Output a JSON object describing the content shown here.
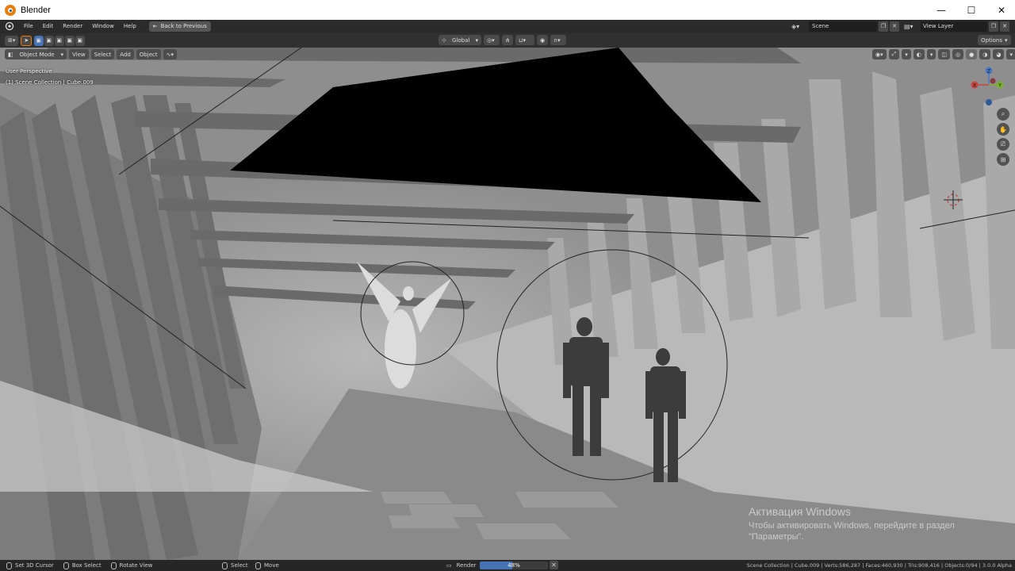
{
  "window": {
    "title": "Blender",
    "minimize": "—",
    "maximize": "☐",
    "close": "✕"
  },
  "topbar": {
    "menus": [
      "File",
      "Edit",
      "Render",
      "Window",
      "Help"
    ],
    "back_label": "Back to Previous",
    "scene_label": "Scene",
    "view_layer_label": "View Layer"
  },
  "tool_header": {
    "orientation": "Global",
    "options_label": "Options"
  },
  "viewport_header": {
    "mode": "Object Mode",
    "menus": [
      "View",
      "Select",
      "Add",
      "Object"
    ]
  },
  "viewport_overlay": {
    "perspective": "User Perspective",
    "collection": "(1) Scene Collection | Cube.009"
  },
  "gizmo": {
    "x": "X",
    "y": "Y",
    "z": "Z"
  },
  "activation": {
    "title": "Активация Windows",
    "line1": "Чтобы активировать Windows, перейдите в раздел",
    "line2": "\"Параметры\"."
  },
  "statusbar": {
    "items": [
      "Set 3D Cursor",
      "Box Select",
      "Rotate View",
      "Select",
      "Move"
    ],
    "render_label": "Render",
    "progress_text": "48%",
    "progress": 0.48,
    "stats": "Scene Collection | Cube.009 | Verts:586,287 | Faces:460,930 | Tris:908,416 | Objects:0/94 | 3.0.0 Alpha"
  },
  "colors": {
    "accent": "#4772b3",
    "orange": "#e87d0d"
  }
}
